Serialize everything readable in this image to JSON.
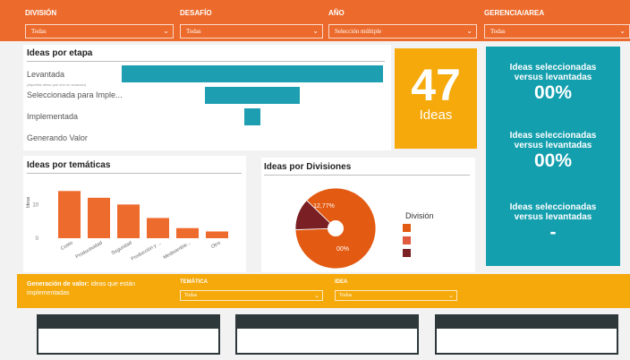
{
  "filters": [
    {
      "title": "DIVISIÓN",
      "value": "Todas"
    },
    {
      "title": "DESAFÍO",
      "value": "Todas"
    },
    {
      "title": "AÑO",
      "value": "Selección múltiple"
    },
    {
      "title": "GERENCIA/AREA",
      "value": "Todas"
    }
  ],
  "funnel": {
    "title": "Ideas por etapa",
    "stages": [
      {
        "label": "Levantada",
        "sublabel": "(Aquellas ideas que aún no avanzan)",
        "value": 1.0
      },
      {
        "label": "Seleccionada para Imple...",
        "value": 0.36
      },
      {
        "label": "Implementada",
        "value": 0.06
      },
      {
        "label": "Generando Valor",
        "value": 0
      }
    ]
  },
  "kpi": {
    "number": "47",
    "unit": "Ideas"
  },
  "ratios": [
    {
      "label": "Ideas seleccionadas versus levantadas",
      "value": "00%"
    },
    {
      "label": "Ideas seleccionadas versus levantadas",
      "value": "00%"
    },
    {
      "label": "Ideas seleccionadas versus levantadas",
      "value": "-"
    }
  ],
  "themes": {
    "title": "Ideas por temáticas"
  },
  "divisions": {
    "title": "Ideas por Divisiones",
    "legend_title": "División",
    "legend_colors": [
      "#e35a12",
      "#e05a3d",
      "#7a1f24"
    ]
  },
  "chart_data": [
    {
      "type": "bar",
      "title": "Ideas por temáticas",
      "categories": [
        "Costo",
        "Productividad",
        "Seguridad",
        "Producción y ...",
        "Medioambie...",
        "Otro"
      ],
      "values": [
        14,
        12,
        10,
        6,
        3,
        2
      ],
      "ylabel": "Ideas",
      "yticks": [
        "0",
        "10"
      ],
      "ylim": [
        0,
        17
      ],
      "color": "#ee6b2e"
    },
    {
      "type": "pie",
      "title": "Ideas por Divisiones",
      "legend_title": "División",
      "slices": [
        {
          "value": 87.23,
          "color": "#e35a12",
          "label": "00%"
        },
        {
          "value": 12.77,
          "color": "#7a1f24",
          "label": "12,77%"
        }
      ]
    }
  ],
  "band": {
    "title_bold": "Generación de valor:",
    "title_rest": " ideas que están implementadas",
    "filters": [
      {
        "title": "TEMÁTICA",
        "value": "Todas"
      },
      {
        "title": "IDEA",
        "value": "Todas"
      }
    ]
  }
}
